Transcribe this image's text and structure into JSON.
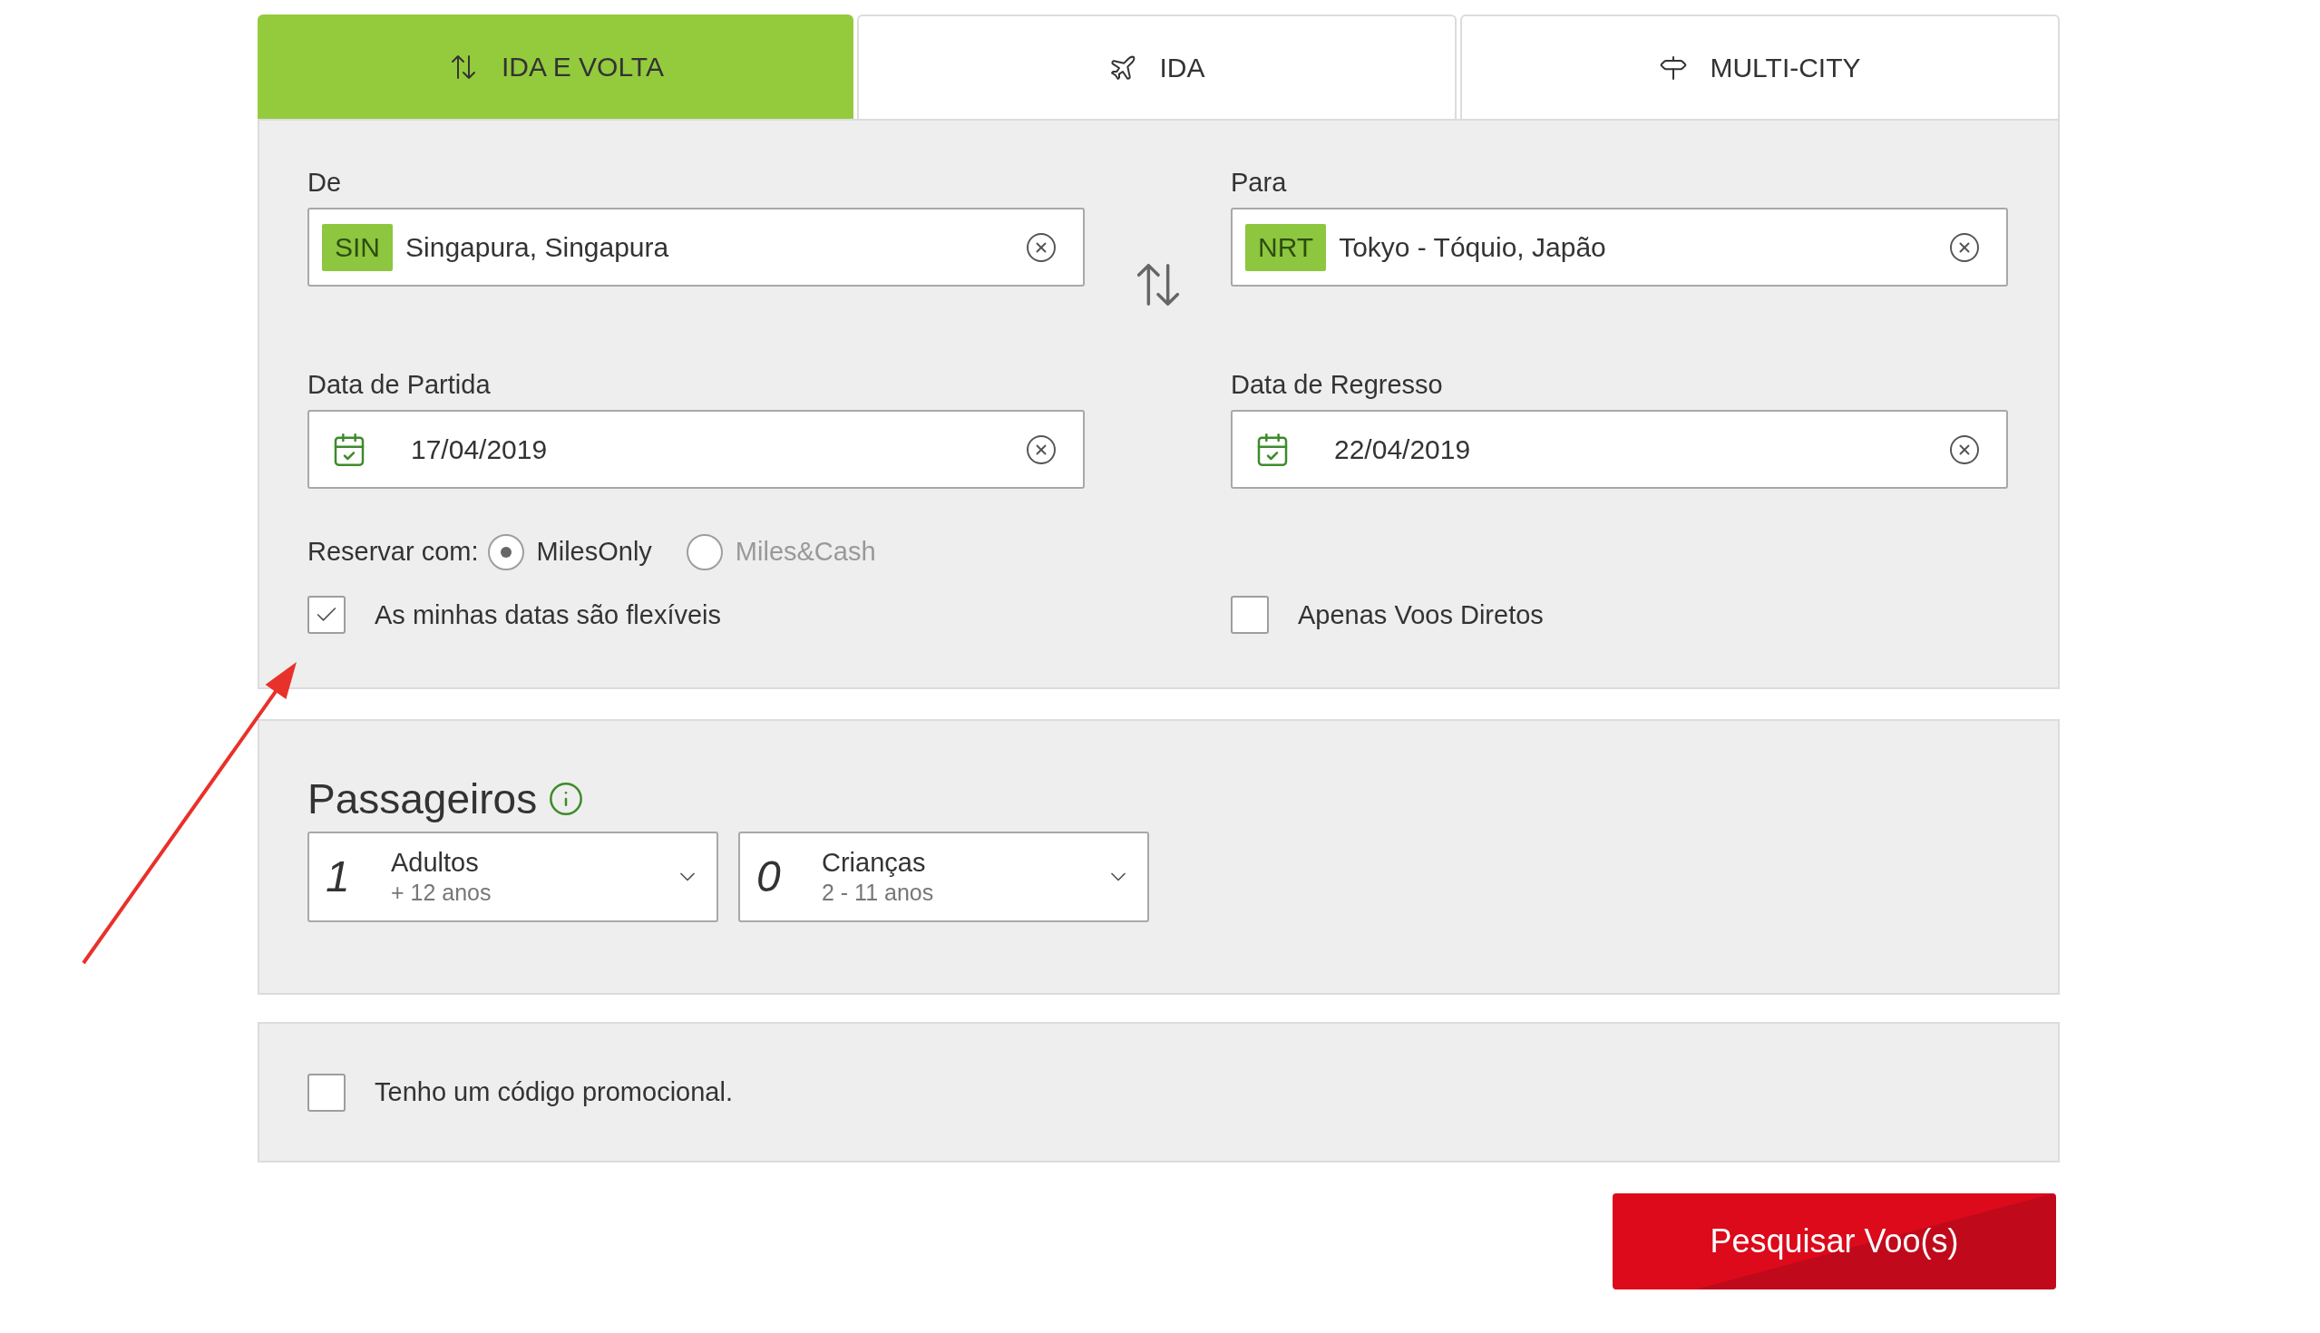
{
  "tabs": [
    {
      "label": "IDA E VOLTA",
      "kind": "swap",
      "selected": true
    },
    {
      "label": "IDA",
      "kind": "plane",
      "selected": false
    },
    {
      "label": "MULTI-CITY",
      "kind": "signpost",
      "selected": false
    }
  ],
  "route": {
    "from": {
      "label": "De",
      "code": "SIN",
      "value": "Singapura, Singapura"
    },
    "to": {
      "label": "Para",
      "code": "NRT",
      "value": "Tokyo - Tóquio, Japão"
    }
  },
  "dates": {
    "departure": {
      "label": "Data de Partida",
      "value": "17/04/2019"
    },
    "return": {
      "label": "Data de Regresso",
      "value": "22/04/2019"
    }
  },
  "booking": {
    "label": "Reservar com:",
    "options": [
      {
        "label": "MilesOnly",
        "selected": true
      },
      {
        "label": "Miles&Cash",
        "selected": false
      }
    ]
  },
  "options": [
    {
      "label": "As minhas datas são flexíveis",
      "checked": true
    },
    {
      "label": "Apenas Voos Diretos",
      "checked": false
    }
  ],
  "passengers": {
    "title": "Passageiros",
    "groups": [
      {
        "count": "1",
        "label": "Adultos",
        "hint": "+ 12 anos"
      },
      {
        "count": "0",
        "label": "Crianças",
        "hint": "2 - 11 anos"
      }
    ]
  },
  "promo": {
    "label": "Tenho um código promocional.",
    "checked": false
  },
  "search_button": "Pesquisar Voo(s)"
}
